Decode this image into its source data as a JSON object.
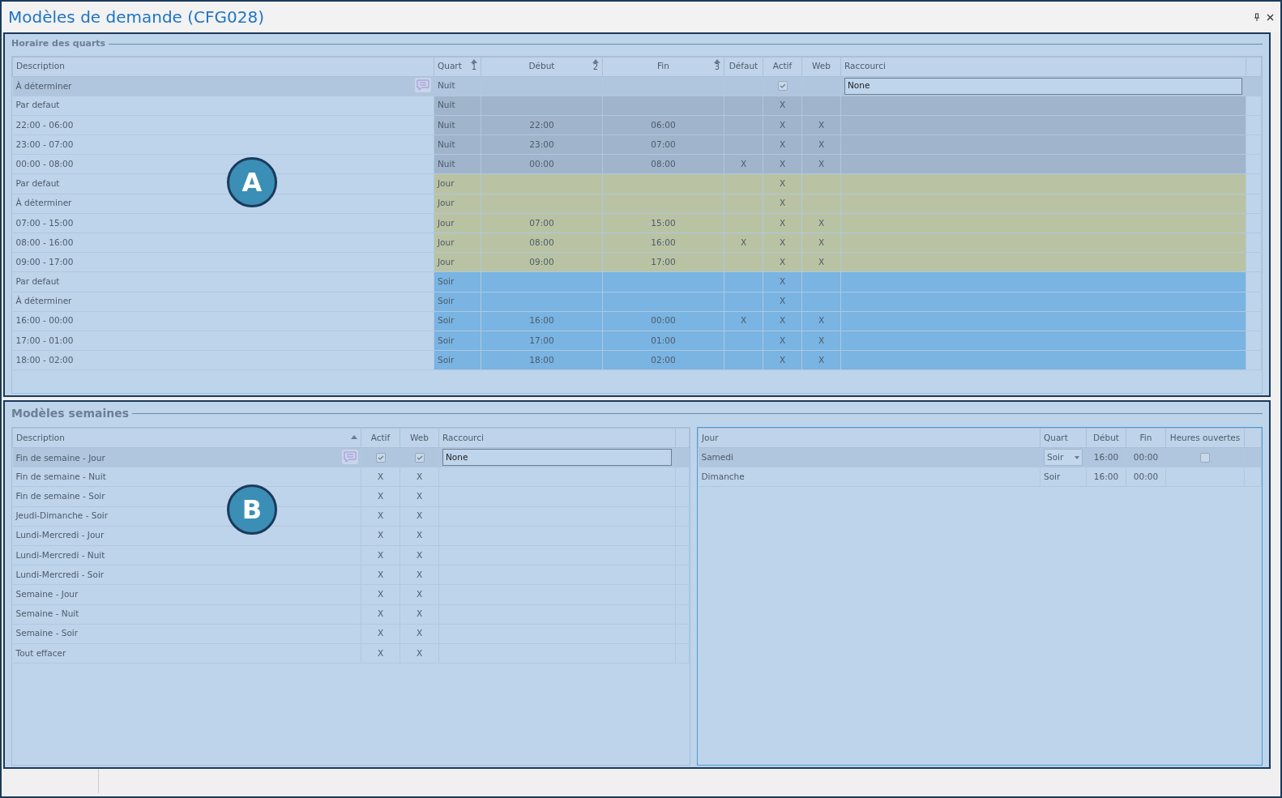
{
  "window": {
    "title": "Modèles de demande (CFG028)"
  },
  "shifts": {
    "title": "Horaire des quarts",
    "callout": "A",
    "columns": [
      {
        "label": "Description"
      },
      {
        "label": "Quart",
        "sorted": true,
        "sort_order": "1"
      },
      {
        "label": "Début",
        "sorted": true,
        "sort_order": "2"
      },
      {
        "label": "Fin",
        "sorted": true,
        "sort_order": "3"
      },
      {
        "label": "Défaut"
      },
      {
        "label": "Actif"
      },
      {
        "label": "Web"
      },
      {
        "label": "Raccourci"
      }
    ],
    "rows": [
      {
        "selected": true,
        "comment": true,
        "cells": [
          "À déterminer",
          "Nuit",
          null,
          null,
          null,
          {
            "kind": "checkbox",
            "checked": true
          },
          null,
          {
            "kind": "field",
            "value": "None"
          }
        ]
      },
      {
        "selected": false,
        "color": "#a0b4cb",
        "cells": [
          "Par defaut",
          "Nuit",
          null,
          null,
          null,
          "X",
          null,
          null
        ]
      },
      {
        "selected": false,
        "color": "#a0b4cb",
        "cells": [
          "22:00 - 06:00",
          "Nuit",
          "22:00",
          "06:00",
          null,
          "X",
          "X",
          null
        ]
      },
      {
        "selected": false,
        "color": "#a0b4cb",
        "cells": [
          "23:00 - 07:00",
          "Nuit",
          "23:00",
          "07:00",
          null,
          "X",
          "X",
          null
        ]
      },
      {
        "selected": false,
        "color": "#a0b4cb",
        "cells": [
          "00:00 - 08:00",
          "Nuit",
          "00:00",
          "08:00",
          "X",
          "X",
          "X",
          null
        ]
      },
      {
        "selected": false,
        "color": "#b9c3a3",
        "cells": [
          "Par defaut",
          "Jour",
          null,
          null,
          null,
          "X",
          null,
          null
        ]
      },
      {
        "selected": false,
        "color": "#b9c3a3",
        "cells": [
          "À déterminer",
          "Jour",
          null,
          null,
          null,
          "X",
          null,
          null
        ]
      },
      {
        "selected": false,
        "color": "#b9c3a3",
        "cells": [
          "07:00 - 15:00",
          "Jour",
          "07:00",
          "15:00",
          null,
          "X",
          "X",
          null
        ]
      },
      {
        "selected": false,
        "color": "#b9c3a3",
        "cells": [
          "08:00 - 16:00",
          "Jour",
          "08:00",
          "16:00",
          "X",
          "X",
          "X",
          null
        ]
      },
      {
        "selected": false,
        "color": "#b9c3a3",
        "cells": [
          "09:00 - 17:00",
          "Jour",
          "09:00",
          "17:00",
          null,
          "X",
          "X",
          null
        ]
      },
      {
        "selected": false,
        "color": "#79b4e2",
        "cells": [
          "Par defaut",
          "Soir",
          null,
          null,
          null,
          "X",
          null,
          null
        ]
      },
      {
        "selected": false,
        "color": "#79b4e2",
        "cells": [
          "À déterminer",
          "Soir",
          null,
          null,
          null,
          "X",
          null,
          null
        ]
      },
      {
        "selected": false,
        "color": "#79b4e2",
        "cells": [
          "16:00 - 00:00",
          "Soir",
          "16:00",
          "00:00",
          "X",
          "X",
          "X",
          null
        ]
      },
      {
        "selected": false,
        "color": "#79b4e2",
        "cells": [
          "17:00 - 01:00",
          "Soir",
          "17:00",
          "01:00",
          null,
          "X",
          "X",
          null
        ]
      },
      {
        "selected": false,
        "color": "#79b4e2",
        "cells": [
          "18:00 - 02:00",
          "Soir",
          "18:00",
          "02:00",
          null,
          "X",
          "X",
          null
        ]
      }
    ]
  },
  "weeks": {
    "title": "Modèles semaines",
    "callout": "B",
    "models": {
      "columns": [
        {
          "label": "Description",
          "sorted": true
        },
        {
          "label": "Actif"
        },
        {
          "label": "Web"
        },
        {
          "label": "Raccourci"
        }
      ],
      "rows": [
        {
          "selected": true,
          "comment": true,
          "cells": [
            "Fin de semaine - Jour",
            {
              "kind": "checkbox",
              "checked": true
            },
            {
              "kind": "checkbox",
              "checked": true
            },
            {
              "kind": "field",
              "value": "None"
            }
          ]
        },
        {
          "selected": false,
          "cells": [
            "Fin de semaine - Nuit",
            "X",
            "X",
            null
          ]
        },
        {
          "selected": false,
          "cells": [
            "Fin de semaine - Soir",
            "X",
            "X",
            null
          ]
        },
        {
          "selected": false,
          "cells": [
            "Jeudi-Dimanche - Soir",
            "X",
            "X",
            null
          ]
        },
        {
          "selected": false,
          "cells": [
            "Lundi-Mercredi - Jour",
            "X",
            "X",
            null
          ]
        },
        {
          "selected": false,
          "cells": [
            "Lundi-Mercredi - Nuit",
            "X",
            "X",
            null
          ]
        },
        {
          "selected": false,
          "cells": [
            "Lundi-Mercredi - Soir",
            "X",
            "X",
            null
          ]
        },
        {
          "selected": false,
          "cells": [
            "Semaine - Jour",
            "X",
            "X",
            null
          ]
        },
        {
          "selected": false,
          "cells": [
            "Semaine - Nuit",
            "X",
            "X",
            null
          ]
        },
        {
          "selected": false,
          "cells": [
            "Semaine - Soir",
            "X",
            "X",
            null
          ]
        },
        {
          "selected": false,
          "cells": [
            "Tout effacer",
            "X",
            "X",
            null
          ]
        }
      ]
    },
    "days": {
      "columns": [
        {
          "label": "Jour"
        },
        {
          "label": "Quart"
        },
        {
          "label": "Début"
        },
        {
          "label": "Fin"
        },
        {
          "label": "Heures ouvertes"
        }
      ],
      "rows": [
        {
          "selected": true,
          "cells": [
            "Samedi",
            {
              "kind": "dropdown",
              "value": "Soir"
            },
            "16:00",
            "00:00",
            {
              "kind": "checkbox",
              "checked": false
            }
          ]
        },
        {
          "selected": false,
          "cells": [
            "Dimanche",
            "Soir",
            "16:00",
            "00:00",
            null
          ]
        }
      ]
    }
  }
}
